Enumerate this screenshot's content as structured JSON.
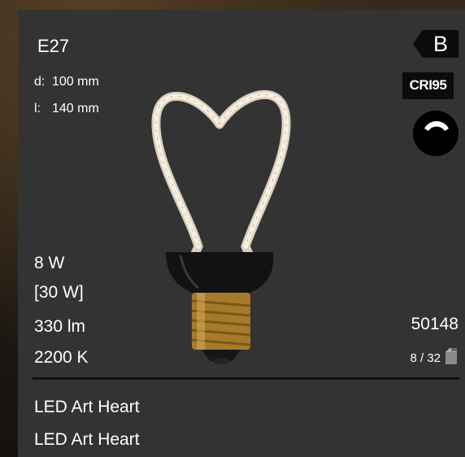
{
  "socket": "E27",
  "dimensions": {
    "diameter_key": "d:",
    "diameter": "100 mm",
    "length_key": "l:",
    "length": "140 mm"
  },
  "energy_class": "B",
  "cri": "CRI95",
  "power": "8 W",
  "equivalent_power": "[30 W]",
  "luminous_flux": "330 lm",
  "color_temperature": "2200 K",
  "article_number": "50148",
  "packaging": "8 / 32",
  "names": [
    "LED Art Heart",
    "LED Art Heart"
  ],
  "icons": {
    "energy": "energy-class-arrow-icon",
    "dimmable": "dimmable-icon",
    "packaging": "box-icon"
  },
  "colors": {
    "card": "#333333",
    "label_bg": "#0b0b0b",
    "filament": "#f4ead8",
    "base": "#b8862e"
  }
}
